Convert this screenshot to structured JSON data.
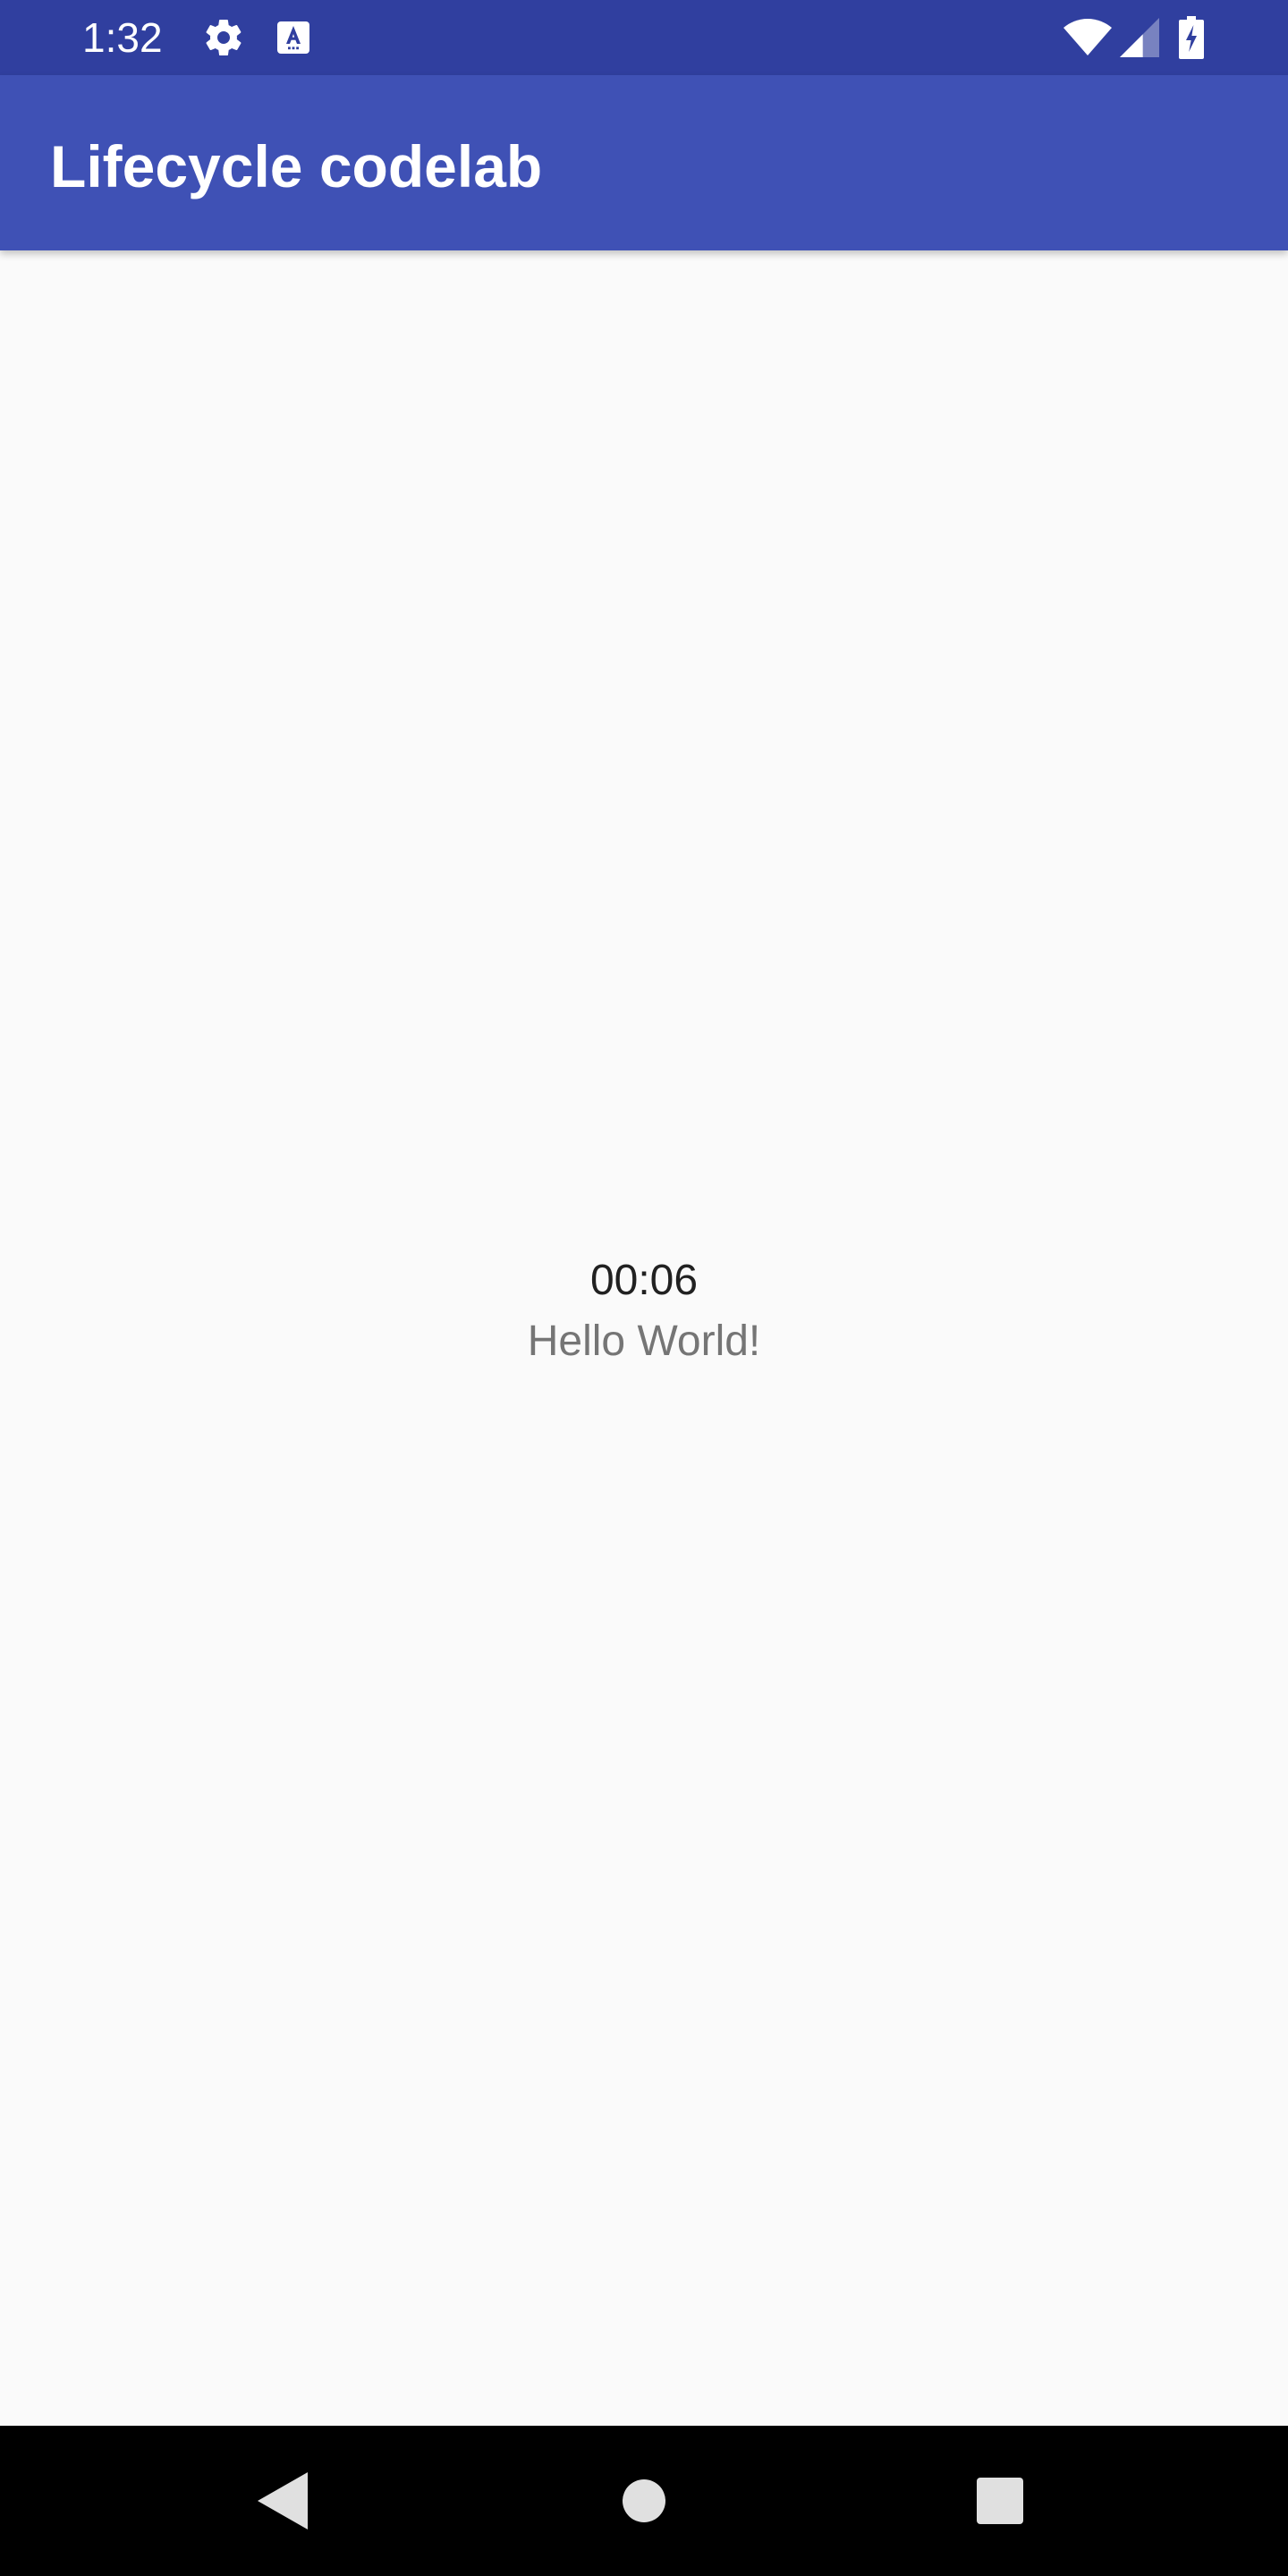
{
  "status_bar": {
    "time": "1:32",
    "background_color": "#303f9f",
    "icons_left": [
      "gear-icon",
      "text-a-icon"
    ],
    "icons_right": [
      "wifi-icon",
      "cell-signal-icon",
      "battery-charging-icon"
    ]
  },
  "app_bar": {
    "title": "Lifecycle codelab",
    "background_color": "#3f51b5"
  },
  "main": {
    "timer": "00:06",
    "message": "Hello World!"
  },
  "nav_bar": {
    "buttons": [
      "back-icon",
      "home-icon",
      "recents-icon"
    ]
  }
}
